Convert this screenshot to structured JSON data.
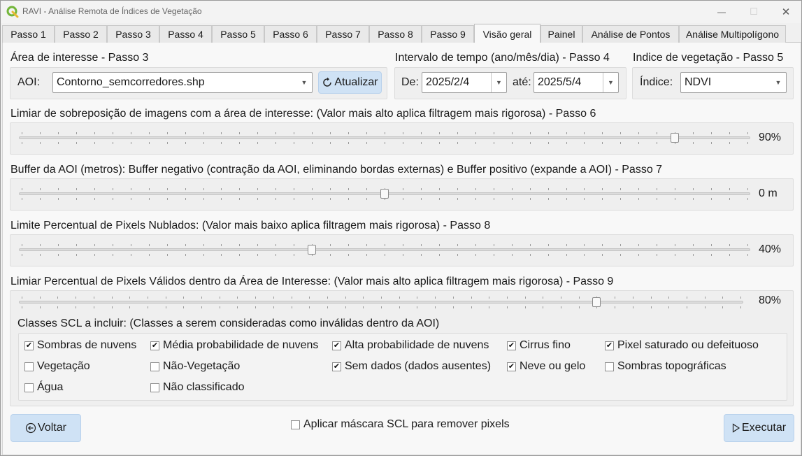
{
  "window": {
    "title": "RAVI - Análise Remota de Índices de Vegetação",
    "minimize": "—",
    "maximize": "☐",
    "close": "✕"
  },
  "tabs": [
    "Passo 1",
    "Passo 2",
    "Passo 3",
    "Passo 4",
    "Passo 5",
    "Passo 6",
    "Passo 7",
    "Passo 8",
    "Passo 9",
    "Visão geral",
    "Painel",
    "Análise de Pontos",
    "Análise Multipolígono"
  ],
  "active_tab": "Visão geral",
  "aoi": {
    "section_label": "Área de interesse - Passo 3",
    "field_label": "AOI:",
    "value": "Contorno_semcorredores.shp",
    "refresh_label": "Atualizar"
  },
  "interval": {
    "section_label": "Intervalo de tempo (ano/mês/dia) - Passo 4",
    "from_label": "De:",
    "from_value": "2025/2/4",
    "to_label": "até:",
    "to_value": "2025/5/4"
  },
  "index": {
    "section_label": "Indice de vegetação - Passo 5",
    "field_label": "Índice:",
    "value": "NDVI"
  },
  "sliders": {
    "overlap": {
      "label": "Limiar de sobreposição de imagens com a área de interesse: (Valor mais alto aplica filtragem mais rigorosa) - Passo 6",
      "value_text": "90%",
      "fraction": 0.9
    },
    "buffer": {
      "label": "Buffer da AOI (metros): Buffer negativo (contração da AOI, eliminando bordas externas) e Buffer positivo (expande a AOI) - Passo 7",
      "value_text": "0 m",
      "fraction": 0.5
    },
    "cloud": {
      "label": "Limite Percentual de Pixels Nublados: (Valor mais baixo aplica filtragem mais rigorosa) - Passo 8",
      "value_text": "40%",
      "fraction": 0.4
    },
    "valid": {
      "label": "Limiar Percentual de Pixels Válidos dentro da Área de Interesse: (Valor mais alto aplica filtragem mais rigorosa) - Passo 9",
      "value_text": "80%",
      "fraction": 0.8
    }
  },
  "scl": {
    "label": "Classes SCL a incluir: (Classes a serem consideradas como inválidas dentro da AOI)",
    "items": [
      {
        "label": "Sombras de nuvens",
        "checked": true
      },
      {
        "label": "Média probabilidade de nuvens",
        "checked": true
      },
      {
        "label": "Alta probabilidade de nuvens",
        "checked": true
      },
      {
        "label": "Cirrus fino",
        "checked": true
      },
      {
        "label": "Pixel saturado ou defeituoso",
        "checked": true
      },
      {
        "label": "Vegetação",
        "checked": false
      },
      {
        "label": "Não-Vegetação",
        "checked": false
      },
      {
        "label": "Sem dados (dados ausentes)",
        "checked": true
      },
      {
        "label": "Neve ou gelo",
        "checked": true
      },
      {
        "label": "Sombras topográficas",
        "checked": false
      },
      {
        "label": "Água",
        "checked": false
      },
      {
        "label": "Não classificado",
        "checked": false
      }
    ]
  },
  "mask": {
    "label": "Aplicar máscara SCL para remover pixels",
    "checked": false
  },
  "footer": {
    "back_label": "Voltar",
    "run_label": "Executar"
  },
  "icons": {
    "app": "qgis-icon",
    "refresh": "refresh-icon",
    "back": "back-arrow-icon",
    "run": "play-icon"
  }
}
